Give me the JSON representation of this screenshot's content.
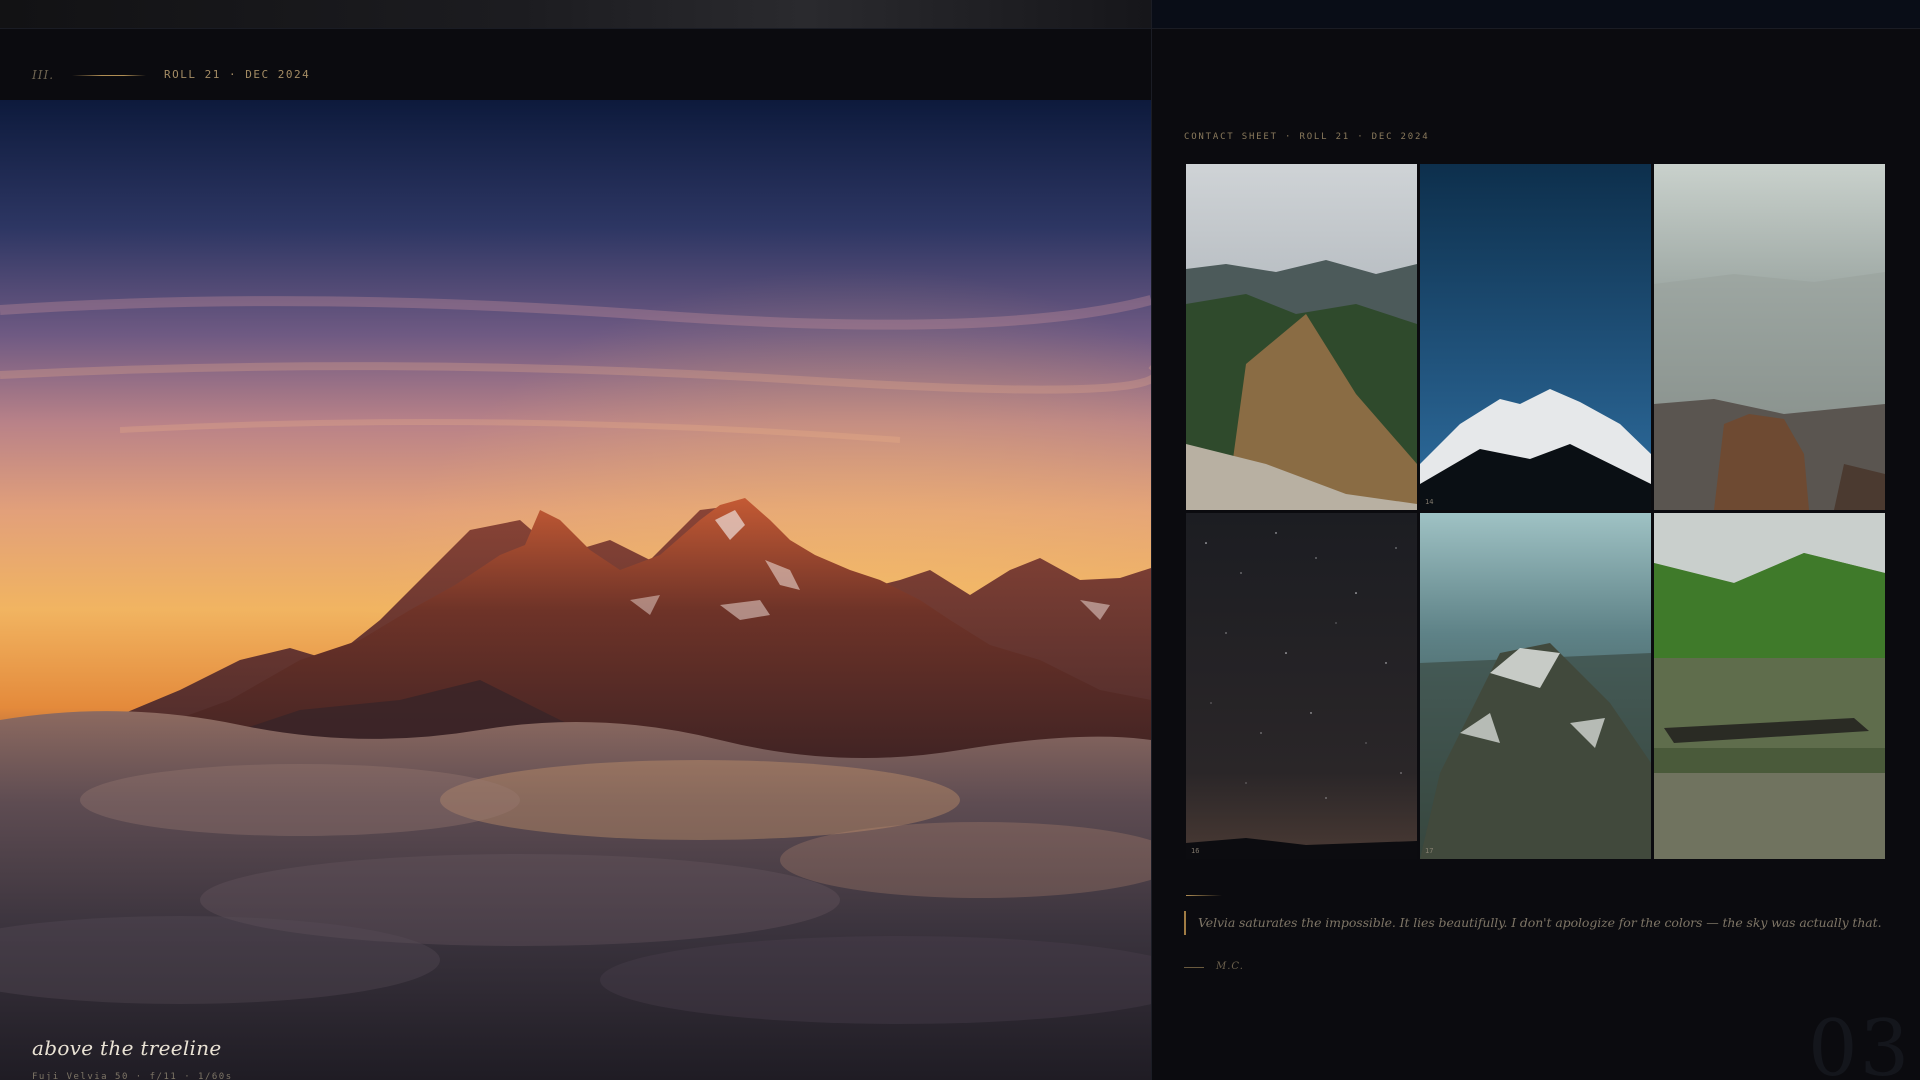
{
  "header": {
    "section_numeral": "III.",
    "roll_label": "ROLL 21 · DEC 2024"
  },
  "hero": {
    "title": "above the treeline",
    "meta": "Fuji Velvia 50 · f/11 · 1/60s"
  },
  "contact_sheet": {
    "label": "CONTACT SHEET · ROLL 21 · DEC 2024",
    "frames": [
      {
        "number": "",
        "subject": "green mountain ridge under clouds"
      },
      {
        "number": "14",
        "subject": "snow peak against blue sky"
      },
      {
        "number": "",
        "subject": "hazy valley with rock outcrop"
      },
      {
        "number": "16",
        "subject": "starry night sky over horizon"
      },
      {
        "number": "17",
        "subject": "aerial view of snowy mountains"
      },
      {
        "number": "",
        "subject": "forest reflected in lake"
      }
    ]
  },
  "quote": {
    "text": "Velvia saturates the impossible. It lies beautifully. I don't apologize for the colors — the sky was actually that.",
    "signature": "M.C."
  },
  "page_number": "03",
  "colors": {
    "accent_gold": "#b08e54",
    "background": "#0b0b0f",
    "panel_dark": "#090d17"
  }
}
